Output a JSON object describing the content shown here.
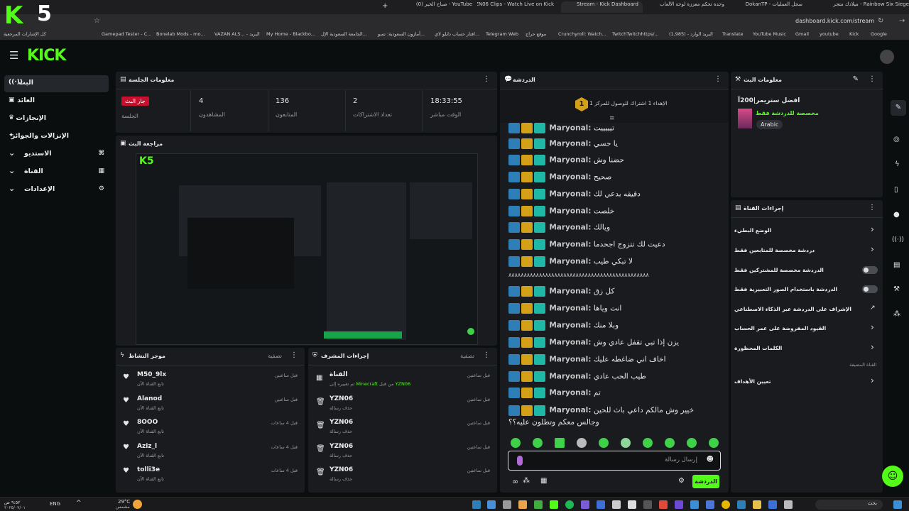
{
  "browser": {
    "tabs": [
      {
        "label": "Rainbow Six Siege - ميلادك متجر"
      },
      {
        "label": "سجل العمليات - DokanTP"
      },
      {
        "label": "وحدة تحكم معززة لوحة الألعاب"
      },
      {
        "label": "Stream - Kick Dashboard"
      },
      {
        "label": "YZN06 Clips - Watch Live on Kick"
      },
      {
        "label": "YouTube - صباح الخير (0)"
      }
    ],
    "url": "dashboard.kick.com/stream",
    "bookmarks": [
      "كل الإشارات المرجعية",
      "Gamepad Tester - C...",
      "Bonelab Mods - mo...",
      "VAZAN ALS... - البريد",
      "My Home - Blackbo...",
      "الجامعة السعودية الإل...",
      "أمازون السعودية: تسو...",
      "افتار حساب دايلو لاي...",
      "Telegram Web",
      "موقع حراج",
      "Crunchyroll: Watch...",
      "TwitchTwitchhttps/...",
      "(1,985) - البريد الوارد",
      "Translate",
      "YouTube Music",
      "Gmail",
      "youtube",
      "Kick",
      "Google"
    ]
  },
  "overlay_badge": "5",
  "header": {
    "logo": "KICK"
  },
  "sidebar": {
    "items": [
      {
        "label": "البث",
        "icon": "broadcast-icon"
      },
      {
        "label": "العائد",
        "icon": "wallet-icon"
      },
      {
        "label": "الإنجازات",
        "icon": "trophy-icon"
      },
      {
        "label": "الإنزالات والجوائز",
        "icon": "gift-icon"
      },
      {
        "label": "الاستديو",
        "icon": "studio-icon"
      },
      {
        "label": "القناة",
        "icon": "channel-icon"
      },
      {
        "label": "الإعدادات",
        "icon": "gear-icon"
      }
    ]
  },
  "session": {
    "title": "معلومات الجلسة",
    "live_badge": "جار البث",
    "session_label": "الجلسة",
    "stats": [
      {
        "value": "4",
        "label": "المشاهدون"
      },
      {
        "value": "136",
        "label": "المتابعون"
      },
      {
        "value": "2",
        "label": "تعداد الاشتراكات"
      },
      {
        "value": "18:33:55",
        "label": "الوقت مباشر"
      }
    ]
  },
  "preview": {
    "title": "مراجعة البث"
  },
  "activity": {
    "title": "موجز النشاط",
    "filter": "تصفية",
    "items": [
      {
        "name": "M50_9lx",
        "sub": "تابع القناة الآن",
        "time": "قبل ساعتين"
      },
      {
        "name": "Alanod",
        "sub": "تابع القناة الآن",
        "time": "قبل ساعتين"
      },
      {
        "name": "8OOO",
        "sub": "تابع القناة الآن",
        "time": "قبل 4 ساعات"
      },
      {
        "name": "Aziz_l",
        "sub": "تابع القناة الآن",
        "time": "قبل 4 ساعات"
      },
      {
        "name": "tolli3e",
        "sub": "تابع القناة الآن",
        "time": "قبل 4 ساعات"
      }
    ]
  },
  "modactions": {
    "title": "إجراءات المشرف",
    "filter": "تصفية",
    "items": [
      {
        "name": "القناة",
        "sub_prefix": "تم تغييره إلى",
        "sub_game": "Minecraft",
        "sub_mid": "من قبل",
        "sub_user": "YZN06",
        "time": "قبل ساعتين"
      },
      {
        "name": "YZN06",
        "sub": "حذف رسالة",
        "time": "قبل ساعتين"
      },
      {
        "name": "YZN06",
        "sub": "حذف رسالة",
        "time": "قبل ساعتين"
      },
      {
        "name": "YZN06",
        "sub": "حذف رسالة",
        "time": "قبل ساعتين"
      },
      {
        "name": "YZN06",
        "sub": "حذف رسالة",
        "time": "قبل ساعتين"
      }
    ]
  },
  "chat": {
    "title": "الدردشة",
    "pinned": "الإهداء 1 اشتراك للوصول للمركز 1",
    "pinned_rank": "1",
    "username": "Maryonal:",
    "messages": [
      "تيييييت",
      "يا حسي",
      "حضنا وش",
      "صحيح",
      "دقيقه بدعي لك",
      "خلصت",
      "ويالك",
      "دعيت لك تتزوج اجحدما",
      "لا تبكي طيب"
    ],
    "separator": "٨٨٨٨٨٨٨٨٨٨٨٨٨٨٨٨٨٨٨٨٨٨٨٨٨٨٨٨٨٨٨٨٨٨٨٨٨٨٨٨٨٨٨٨٨٨",
    "messages2": [
      "كل زق",
      "انت وياها",
      "وبلا منك",
      "يزن إذا تبي تقفل عادي وش",
      "اخاف اني ضاغطه عليك",
      "طيب الحب عادي",
      "تم",
      "خيير وش مالكم داعي باث للحين وجالس معكم وتطلون عليه؟؟"
    ],
    "input_placeholder": "إرسال رسالة",
    "send_label": "الدردشة"
  },
  "stream_info": {
    "title": "معلومات البث",
    "stream_title": "افضل ستريمر|200آ",
    "category": "مخصصة للدردشة فقط",
    "language": "Arabic"
  },
  "channel_actions": {
    "title": "إجراءات القناة",
    "rows": [
      {
        "label": "الوضع البطيء",
        "type": "chevron"
      },
      {
        "label": "دردشة مخصصة للمتابعين فقط",
        "type": "chevron"
      },
      {
        "label": "الدردشة مخصصة للمشتركين فقط",
        "type": "toggle"
      },
      {
        "label": "الدردشة باستخدام الصور التعبيرية فقط",
        "type": "toggle"
      },
      {
        "label": "الإشراف على الدردشة عبر الذكاء الاصطناعي",
        "type": "external"
      },
      {
        "label": "القيود المفروضة على عمر الحساب",
        "type": "chevron"
      },
      {
        "label": "الكلمات المحظورة",
        "type": "chevron"
      }
    ],
    "section_label": "القناة المضيفة",
    "goals": "تعيين الأهداف"
  },
  "taskbar": {
    "weather": "29°C",
    "weather_sub": "مشمس",
    "lang": "ENG",
    "time": "٩:٥٢ ص",
    "date": "٢٠٢٥/٠٧/٠١",
    "search": "بحث"
  }
}
